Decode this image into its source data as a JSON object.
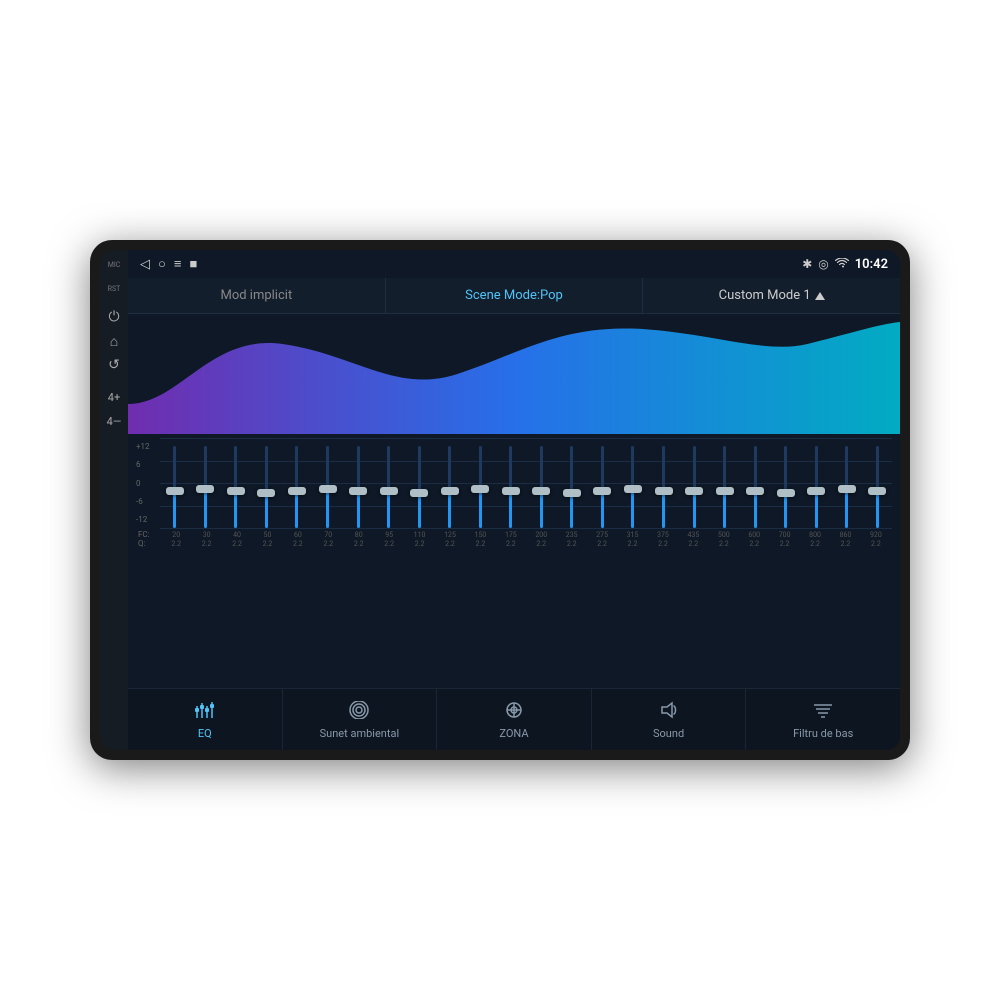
{
  "device": {
    "status_bar": {
      "mic_label": "MIC",
      "rst_label": "RST",
      "time": "10:42",
      "nav_back": "◁",
      "nav_circle": "○",
      "nav_menu": "≡",
      "nav_square": "■"
    },
    "mode_bar": {
      "tab1": "Mod implicit",
      "tab2": "Scene Mode:Pop",
      "tab3_prefix": "Custom Mode 1"
    },
    "eq": {
      "y_labels": [
        "+12",
        "6",
        "0",
        "-6",
        "-12"
      ],
      "freq_centers": [
        "20",
        "30",
        "40",
        "50",
        "60",
        "70",
        "80",
        "95",
        "110",
        "125",
        "150",
        "175",
        "200",
        "235",
        "275",
        "315",
        "375",
        "435",
        "500",
        "600",
        "700",
        "800",
        "860",
        "920"
      ],
      "q_values": [
        "2.2",
        "2.2",
        "2.2",
        "2.2",
        "2.2",
        "2.2",
        "2.2",
        "2.2",
        "2.2",
        "2.2",
        "2.2",
        "2.2",
        "2.2",
        "2.2",
        "2.2",
        "2.2",
        "2.2",
        "2.2",
        "2.2",
        "2.2",
        "2.2",
        "2.2",
        "2.2",
        "2.2"
      ],
      "fc_prefix": "FC:",
      "q_prefix": "Q:",
      "slider_positions": [
        50,
        50,
        50,
        50,
        50,
        50,
        50,
        50,
        50,
        50,
        50,
        50,
        50,
        50,
        50,
        50,
        50,
        50,
        50,
        50,
        50,
        50,
        50,
        50
      ]
    },
    "bottom_nav": {
      "items": [
        {
          "label": "EQ",
          "icon": "sliders",
          "active": true
        },
        {
          "label": "Sunet ambiental",
          "icon": "wifi-circle",
          "active": false
        },
        {
          "label": "ZONA",
          "icon": "target",
          "active": false
        },
        {
          "label": "Sound",
          "icon": "speaker",
          "active": false
        },
        {
          "label": "Filtru de bas",
          "icon": "filter",
          "active": false
        }
      ]
    },
    "side_buttons": [
      {
        "label": "MIC",
        "icon": "mic"
      },
      {
        "label": "RST",
        "icon": "rst"
      },
      {
        "label": "⏻",
        "icon": "power"
      },
      {
        "label": "⌂",
        "icon": "home"
      },
      {
        "label": "↺",
        "icon": "back"
      },
      {
        "label": "4+",
        "icon": "vol-up"
      },
      {
        "label": "4-",
        "icon": "vol-down"
      }
    ]
  }
}
